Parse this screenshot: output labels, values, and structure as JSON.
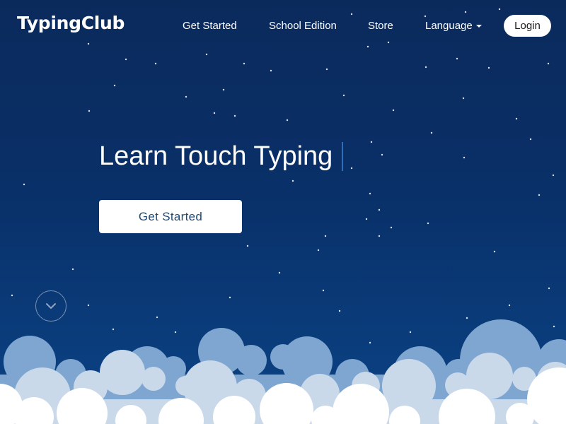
{
  "header": {
    "logo": "TypingClub",
    "nav": {
      "get_started": "Get Started",
      "school_edition": "School Edition",
      "store": "Store",
      "language": "Language"
    },
    "login": "Login"
  },
  "hero": {
    "headline": "Learn Touch Typing",
    "cta_label": "Get Started"
  },
  "icons": {
    "language_dropdown": "caret-down-icon",
    "scroll_down": "chevron-down-icon"
  },
  "colors": {
    "sky_top": "#0b2a5c",
    "sky_bottom": "#0a4386",
    "cloud_back": "#7ea6d0",
    "cloud_mid": "#c9d9ea",
    "cloud_front": "#ffffff",
    "cta_text": "#1e4a7a"
  }
}
